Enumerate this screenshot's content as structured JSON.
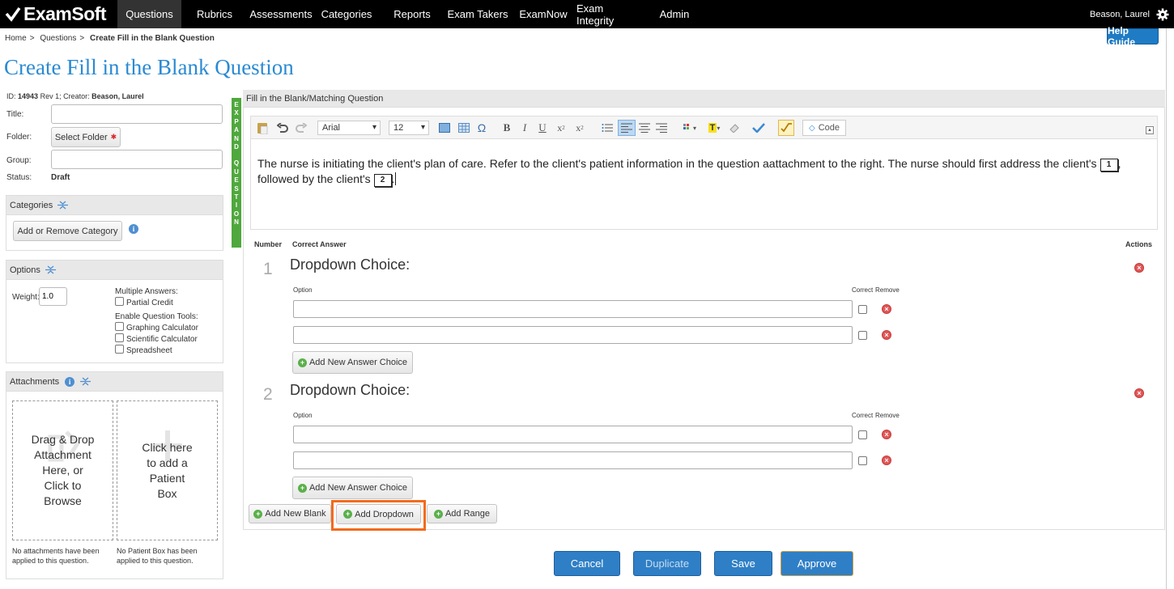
{
  "brand": {
    "name": "ExamSoft"
  },
  "nav": {
    "items": [
      {
        "label": "Questions",
        "active": true
      },
      {
        "label": "Rubrics"
      },
      {
        "label": "Assessments"
      },
      {
        "label": "Categories"
      },
      {
        "label": "Reports"
      },
      {
        "label": "Exam Takers"
      },
      {
        "label": "ExamNow"
      },
      {
        "label": "Exam Integrity"
      },
      {
        "label": "Admin"
      }
    ],
    "user": "Beason, Laurel",
    "settings_icon": "gear-icon"
  },
  "breadcrumb": {
    "home": "Home",
    "sep": ">",
    "questions": "Questions",
    "current": "Create Fill in the Blank Question"
  },
  "help_label": "Help Guide",
  "page_title": "Create Fill in the Blank Question",
  "meta": {
    "id_prefix": "ID:",
    "id": "14943",
    "rev": "Rev 1; Creator:",
    "creator": "Beason, Laurel"
  },
  "form": {
    "title_label": "Title:",
    "title_value": "",
    "folder_label": "Folder:",
    "select_folder": "Select Folder",
    "required_mark": "✱",
    "group_label": "Group:",
    "group_value": "",
    "status_label": "Status:",
    "status_value": "Draft"
  },
  "categories": {
    "title": "Categories",
    "add_remove": "Add or Remove Category"
  },
  "options": {
    "title": "Options",
    "weight_label": "Weight:",
    "weight_value": "1.0",
    "multiple_answers": "Multiple Answers:",
    "partial_credit": "Partial Credit",
    "enable_tools": "Enable Question Tools:",
    "graphing": "Graphing Calculator",
    "scientific": "Scientific Calculator",
    "spreadsheet": "Spreadsheet"
  },
  "attachments": {
    "title": "Attachments",
    "drop_text": "Drag & Drop Attachment Here, or Click to Browse",
    "patient_text": "Click here to add a Patient Box",
    "none_attach": "No attachments have been applied to this question.",
    "none_patient": "No Patient Box has been applied to this question."
  },
  "editor": {
    "header": "Fill in the Blank/Matching Question",
    "expand_letters": [
      "E",
      "X",
      "P",
      "A",
      "N",
      "D",
      "",
      "Q",
      "U",
      "E",
      "S",
      "T",
      "I",
      "O",
      "N"
    ],
    "font": "Arial",
    "size": "12",
    "code_label": "Code",
    "text_part1": "The nurse is initiating the client's plan of care. Refer to the client's patient information in the question aattachment to the right. The nurse should first address the client's",
    "blank1": "1",
    "text_part2": ", followed by the client's",
    "blank2": "2",
    "text_part3": "."
  },
  "answers": {
    "col_number": "Number",
    "col_correct": "Correct Answer",
    "col_actions": "Actions",
    "option_label": "Option",
    "correct_label": "Correct",
    "remove_label": "Remove",
    "blocks": [
      {
        "number": "1",
        "title": "Dropdown Choice:",
        "add_choice": "Add New Answer Choice"
      },
      {
        "number": "2",
        "title": "Dropdown Choice:",
        "add_choice": "Add New Answer Choice"
      }
    ]
  },
  "add_buttons": {
    "blank": "Add New Blank",
    "dropdown": "Add Dropdown",
    "range": "Add Range"
  },
  "footer": {
    "cancel": "Cancel",
    "duplicate": "Duplicate",
    "save": "Save",
    "approve": "Approve"
  },
  "colors": {
    "accent": "#2a8ad3",
    "highlight": "#f26b1d",
    "expand": "#4fa83d"
  }
}
